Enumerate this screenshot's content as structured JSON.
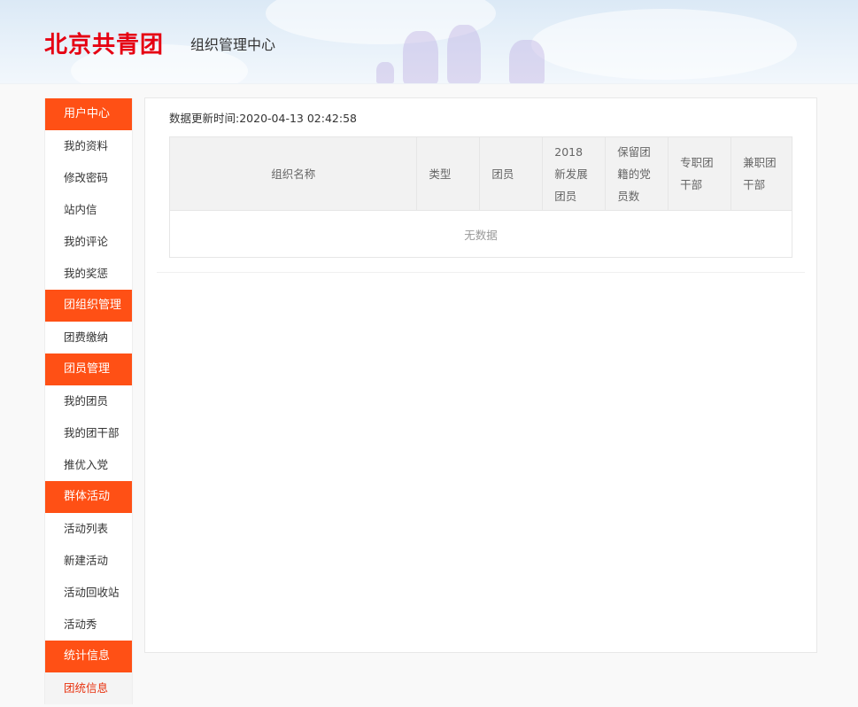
{
  "header": {
    "logo_text": "北京共青团",
    "subtitle": "组织管理中心"
  },
  "sidebar": {
    "sections": [
      {
        "title": "用户中心",
        "items": [
          "我的资料",
          "修改密码",
          "站内信",
          "我的评论",
          "我的奖惩"
        ]
      },
      {
        "title": "团组织管理",
        "items": [
          "团费缴纳"
        ]
      },
      {
        "title": "团员管理",
        "items": [
          "我的团员",
          "我的团干部",
          "推优入党"
        ]
      },
      {
        "title": "群体活动",
        "items": [
          "活动列表",
          "新建活动",
          "活动回收站",
          "活动秀"
        ]
      },
      {
        "title": "统计信息",
        "items": [
          "团统信息"
        ]
      }
    ],
    "active_item": "团统信息"
  },
  "main": {
    "update_label": "数据更新时间:",
    "update_time": "2020-04-13 02:42:58",
    "table": {
      "headers": [
        "组织名称",
        "类型",
        "团员",
        "2018新发展团员",
        "保留团籍的党员数",
        "专职团干部",
        "兼职团干部"
      ],
      "empty_text": "无数据"
    }
  },
  "colors": {
    "accent": "#ff5015",
    "logo": "#e60012",
    "active_text": "#e8320f"
  }
}
